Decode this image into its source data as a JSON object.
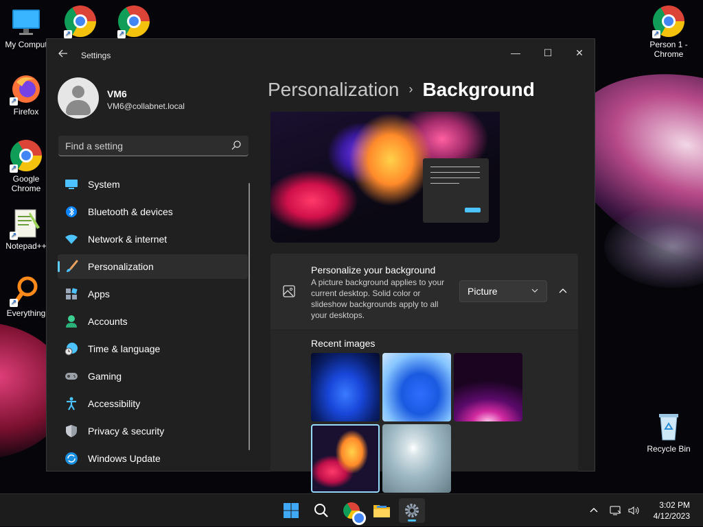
{
  "desktop": {
    "icons": [
      {
        "label": "My Comput"
      },
      {
        "label": ""
      },
      {
        "label": ""
      },
      {
        "label": "Firefox"
      },
      {
        "label": "Google Chrome"
      },
      {
        "label": "Notepad++"
      },
      {
        "label": "Everything"
      },
      {
        "label": "Person 1 - Chrome"
      },
      {
        "label": "Recycle Bin"
      }
    ]
  },
  "window": {
    "title": "Settings",
    "controls": {
      "minimize": "—",
      "maximize": "☐",
      "close": "✕"
    }
  },
  "profile": {
    "name": "VM6",
    "email": "VM6@collabnet.local"
  },
  "search": {
    "placeholder": "Find a setting"
  },
  "sidebar": {
    "items": [
      {
        "label": "System",
        "icon": "monitor-icon"
      },
      {
        "label": "Bluetooth & devices",
        "icon": "bluetooth-icon"
      },
      {
        "label": "Network & internet",
        "icon": "wifi-icon"
      },
      {
        "label": "Personalization",
        "icon": "brush-icon",
        "active": true
      },
      {
        "label": "Apps",
        "icon": "apps-icon"
      },
      {
        "label": "Accounts",
        "icon": "person-icon"
      },
      {
        "label": "Time & language",
        "icon": "clock-globe-icon"
      },
      {
        "label": "Gaming",
        "icon": "gamepad-icon"
      },
      {
        "label": "Accessibility",
        "icon": "accessibility-icon"
      },
      {
        "label": "Privacy & security",
        "icon": "shield-icon"
      },
      {
        "label": "Windows Update",
        "icon": "update-icon"
      }
    ]
  },
  "main": {
    "breadcrumb": {
      "parent": "Personalization",
      "separator": "›",
      "current": "Background"
    },
    "background_card": {
      "title": "Personalize your background",
      "description": "A picture background applies to your current desktop. Solid color or slideshow backgrounds apply to all your desktops.",
      "dropdown_value": "Picture"
    },
    "recent_images": {
      "title": "Recent images",
      "selected_index": 3
    }
  },
  "taskbar": {
    "time": "3:02 PM",
    "date": "4/12/2023"
  },
  "colors": {
    "accent": "#60cdff",
    "window_bg": "#202020",
    "card_bg": "#2b2b2b"
  }
}
